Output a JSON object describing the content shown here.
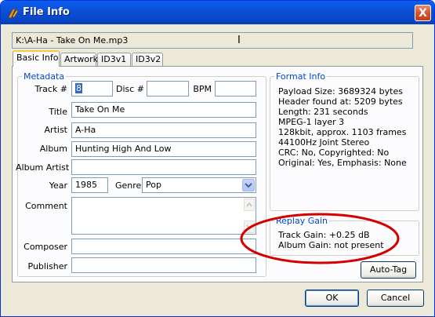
{
  "window": {
    "title": "File Info",
    "close_label": "X"
  },
  "path": {
    "value": "K:\\A-Ha - Take On Me.mp3"
  },
  "tabs": [
    {
      "label": "Basic Info"
    },
    {
      "label": "Artwork"
    },
    {
      "label": "ID3v1"
    },
    {
      "label": "ID3v2"
    }
  ],
  "metadata": {
    "title": "Metadata",
    "track_label": "Track #",
    "track_value": "8",
    "disc_label": "Disc #",
    "disc_value": "",
    "bpm_label": "BPM",
    "bpm_value": "",
    "title_label": "Title",
    "title_value": "Take On Me",
    "artist_label": "Artist",
    "artist_value": "A-Ha",
    "album_label": "Album",
    "album_value": "Hunting High And Low",
    "album_artist_label": "Album Artist",
    "album_artist_value": "",
    "year_label": "Year",
    "year_value": "1985",
    "genre_label": "Genre",
    "genre_value": "Pop",
    "comment_label": "Comment",
    "comment_value": "",
    "composer_label": "Composer",
    "composer_value": "",
    "publisher_label": "Publisher",
    "publisher_value": ""
  },
  "format_info": {
    "title": "Format Info",
    "lines": [
      "Payload Size: 3689324 bytes",
      "Header found at: 5209 bytes",
      "Length: 231 seconds",
      "MPEG-1 layer 3",
      "128kbit, approx. 1103 frames",
      "44100Hz Joint Stereo",
      "CRC: No, Copyrighted: No",
      "Original: Yes, Emphasis: None"
    ]
  },
  "replay_gain": {
    "title": "Replay Gain",
    "lines": [
      "Track Gain: +0.25 dB",
      "Album Gain: not present"
    ]
  },
  "buttons": {
    "autotag": "Auto-Tag",
    "ok": "OK",
    "cancel": "Cancel"
  },
  "colors": {
    "title_bar": "#0c4fd4",
    "group_title": "#0046d5",
    "annotation": "#d40000",
    "selection": "#316ac5"
  }
}
